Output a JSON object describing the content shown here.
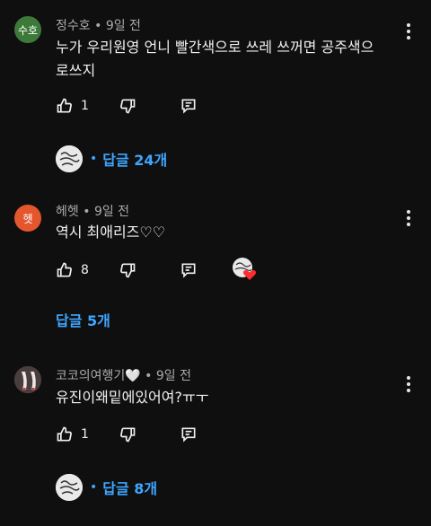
{
  "comments": [
    {
      "author": "정수호",
      "time": "9일 전",
      "avatar_text": "수호",
      "avatar_color": "#3d7a3a",
      "text_lines": [
        "누가 우리원영 언니 빨간색으로 쓰레 쓰꺼면 공주색으",
        "로쓰지"
      ],
      "likes": "1",
      "replies_label": "답글 24개"
    },
    {
      "author": "헤헷",
      "time": "9일 전",
      "avatar_text": "헷",
      "avatar_color": "#e4572e",
      "text_lines": [
        "역시 최애리즈♡♡"
      ],
      "likes": "8",
      "replies_label": "답글 5개"
    },
    {
      "author": "코코의여행기🤍",
      "time": "9일 전",
      "avatar_text": "",
      "avatar_color": "#7a5a5a",
      "text_lines": [
        "유진이왜밑에있어여?ㅠㅜ"
      ],
      "likes": "1",
      "replies_label": "답글 8개"
    }
  ],
  "separator": "•",
  "colors": {
    "background": "#0f0f0f",
    "text": "#f1f1f1",
    "meta": "#aaaaaa",
    "link": "#3ea6ff",
    "heart": "#ff2d2d"
  },
  "icons": [
    "thumb-up-icon",
    "thumb-down-icon",
    "reply-icon",
    "more-vert-icon",
    "heart-icon"
  ]
}
